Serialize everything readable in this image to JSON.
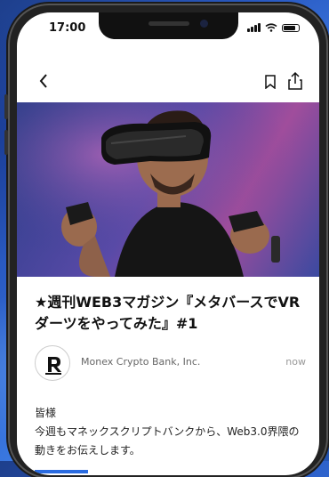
{
  "status_bar": {
    "time": "17:00"
  },
  "article": {
    "title": "★週刊WEB3マガジン『メタバースでVRダーツをやってみた』#1",
    "author": "Monex Crypto Bank, Inc.",
    "timestamp": "now",
    "greeting": "皆様",
    "intro": "今週もマネックスクリプトバンクから、Web3.0界隈の動きをお伝えします。"
  },
  "icons": [
    "back-icon",
    "bookmark-icon",
    "share-icon",
    "signal-icon",
    "wifi-icon",
    "battery-icon"
  ],
  "colors": {
    "background": "#2a5bc4",
    "link": "#2a6be0"
  }
}
